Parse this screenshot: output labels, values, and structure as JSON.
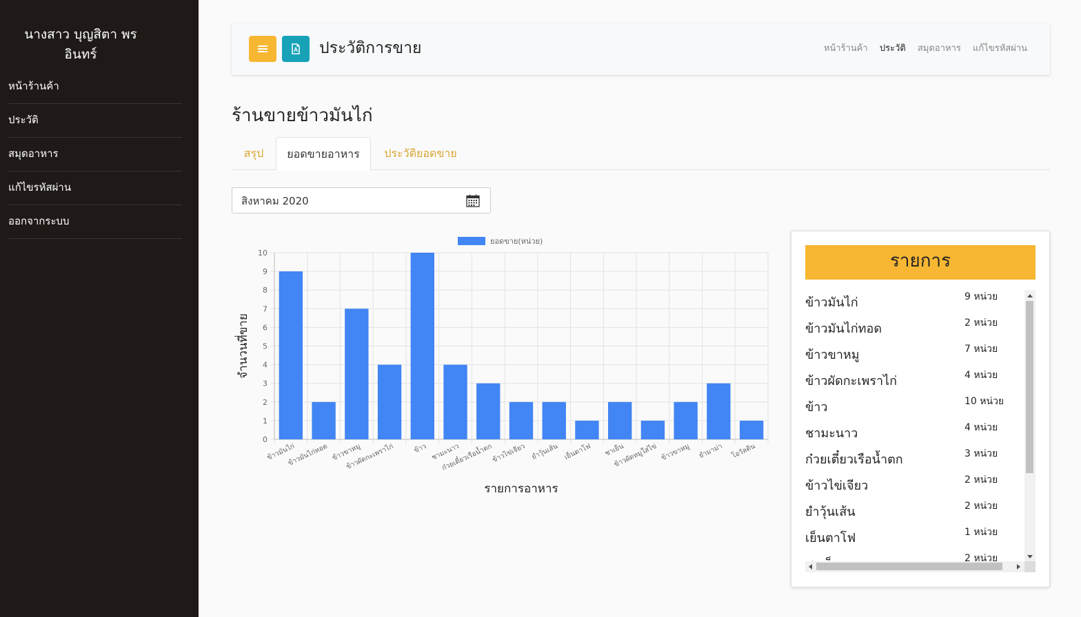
{
  "sidebar": {
    "user_line1": "นางสาว บุญสิตา พร",
    "user_line2": "อินทร์",
    "items": [
      {
        "label": "หน้าร้านค้า"
      },
      {
        "label": "ประวัติ"
      },
      {
        "label": "สมุดอาหาร"
      },
      {
        "label": "แก้ไขรหัสผ่าน"
      },
      {
        "label": "ออกจากระบบ"
      }
    ]
  },
  "header": {
    "title": "ประวัติการขาย",
    "menu_icon": "hamburger-icon",
    "pdf_icon": "pdf-file-icon",
    "nav": [
      {
        "label": "หน้าร้านค้า",
        "active": false
      },
      {
        "label": "ประวัติ",
        "active": true
      },
      {
        "label": "สมุดอาหาร",
        "active": false
      },
      {
        "label": "แก้ไขรหัสผ่าน",
        "active": false
      }
    ]
  },
  "shop_title": "ร้านขายข้าวมันไก่",
  "tabs": [
    {
      "label": "สรุป",
      "active": false
    },
    {
      "label": "ยอดขายอาหาร",
      "active": true
    },
    {
      "label": "ประวัติยอดขาย",
      "active": false
    }
  ],
  "month_picker": {
    "value": "สิงหาคม 2020",
    "icon": "calendar-icon"
  },
  "colors": {
    "accent": "#f7b733",
    "teal": "#17a2b8",
    "bar": "#4285f4",
    "sidebar": "#1f1a17"
  },
  "chart_data": {
    "type": "bar",
    "legend": "ยอดขาย(หน่วย)",
    "xlabel": "รายการอาหาร",
    "ylabel": "จำนวนที่ขาย",
    "ylim": [
      0,
      10
    ],
    "yticks": [
      0,
      1,
      2,
      3,
      4,
      5,
      6,
      7,
      8,
      9,
      10
    ],
    "categories": [
      "ข้าวมันไก่",
      "ข้าวมันไก่ทอด",
      "ข้าวขาหมู",
      "ข้าวผัดกะเพราไก่",
      "ข้าว",
      "ชามะนาว",
      "ก๋วยเตี๋ยวเรือน้ำตก",
      "ข้าวไข่เจียว",
      "ยำวุ้นเส้น",
      "เย็นตาโฟ",
      "ชาเย็น",
      "ข้าวผัดหมูใส่ไข่",
      "ข้าวขาหมู",
      "ยำมาม่า",
      "โอวัลติน"
    ],
    "values": [
      9,
      2,
      7,
      4,
      10,
      4,
      3,
      2,
      2,
      1,
      2,
      1,
      2,
      3,
      1
    ],
    "grid": true,
    "legend_position": "top"
  },
  "list": {
    "title": "รายการ",
    "items": [
      {
        "name": "ข้าวมันไก่",
        "qty": "9 หน่วย"
      },
      {
        "name": "ข้าวมันไก่ทอด",
        "qty": "2 หน่วย"
      },
      {
        "name": "ข้าวขาหมู",
        "qty": "7 หน่วย"
      },
      {
        "name": "ข้าวผัดกะเพราไก่",
        "qty": "4 หน่วย"
      },
      {
        "name": "ข้าว",
        "qty": "10 หน่วย"
      },
      {
        "name": "ชามะนาว",
        "qty": "4 หน่วย"
      },
      {
        "name": "ก๋วยเตี๋ยวเรือน้ำตก",
        "qty": "3 หน่วย"
      },
      {
        "name": "ข้าวไข่เจียว",
        "qty": "2 หน่วย"
      },
      {
        "name": "ยำวุ้นเส้น",
        "qty": "2 หน่วย"
      },
      {
        "name": "เย็นตาโฟ",
        "qty": "1 หน่วย"
      },
      {
        "name": "ชาเย็น",
        "qty": "2 หน่วย"
      }
    ]
  }
}
